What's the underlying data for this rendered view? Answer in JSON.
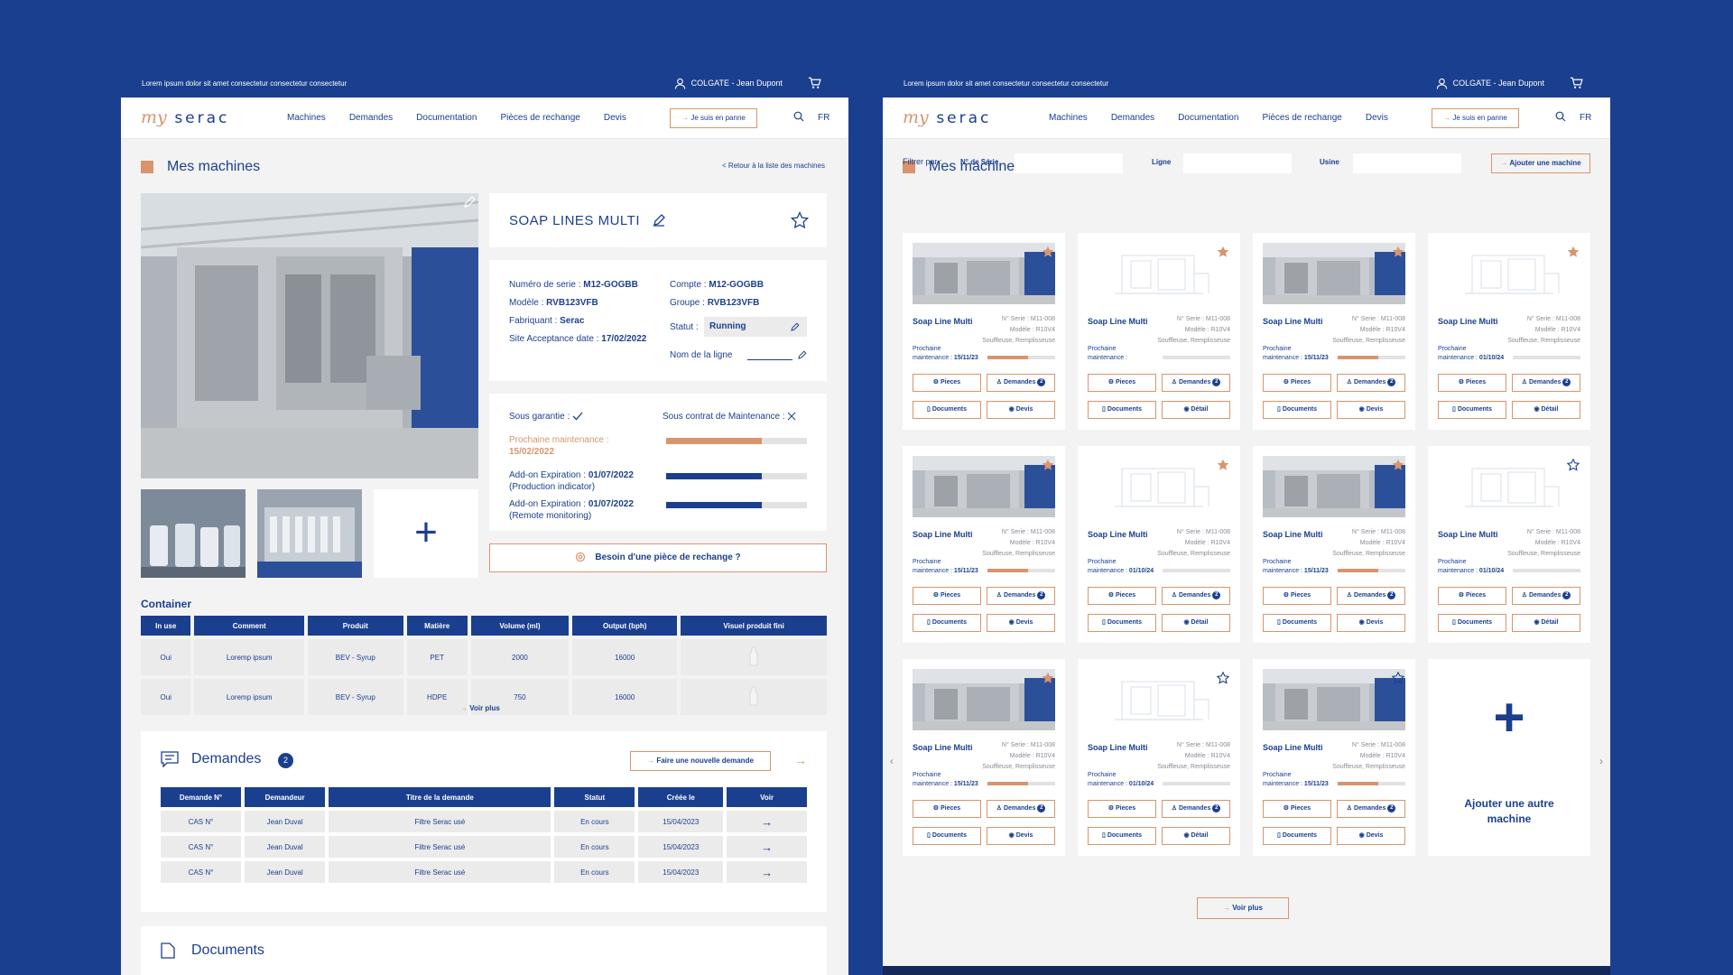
{
  "topbar": {
    "text": "Lorem ipsum dolor sit amet consectetur consectetur consectetur",
    "user": "COLGATE - Jean Dupont"
  },
  "logo": {
    "my": "my",
    "serac": "serac"
  },
  "nav": {
    "items": [
      "Machines",
      "Demandes",
      "Documentation",
      "Pièces de rechange",
      "Devis"
    ],
    "panne": "Je suis en panne",
    "lang": "FR"
  },
  "colors": {
    "primary": "#1b3f8f",
    "accent": "#d9946e",
    "bg": "#f3f3f3"
  },
  "left": {
    "title": "Mes machines",
    "back": "< Retour à la liste des machines",
    "machine_name": "SOAP LINES MULTI",
    "plus": "+",
    "info": {
      "serie_label": "Numéro de serie : ",
      "serie": "M12-GOGBB",
      "modele_label": "Modèle : ",
      "modele": "RVB123VFB",
      "fabriquant_label": "Fabriquant : ",
      "fabriquant": "Serac",
      "site_label": "Site Acceptance date : ",
      "site": "17/02/2022",
      "compte_label": "Compte : ",
      "compte": "M12-GOGBB",
      "groupe_label": "Groupe : ",
      "groupe": "RVB123VFB",
      "statut_label": "Statut : ",
      "statut": "Running",
      "ligne_label": "Nom de la ligne"
    },
    "garantie": {
      "sous_garantie": "Sous garantie : ",
      "sous_contrat": "Sous contrat de Maintenance : ",
      "prochaine_label": "Prochaine maintenance :",
      "prochaine_date": "15/02/2022",
      "prochaine_pct": 0.68,
      "addon1_label": "Add-on Expiration : ",
      "addon1_date": "01/07/2022",
      "addon1_sub": "(Production indicator)",
      "addon1_pct": 0.68,
      "addon2_label": "Add-on Expiration : ",
      "addon2_date": "01/07/2022",
      "addon2_sub": "(Remote monitoring)",
      "addon2_pct": 0.68
    },
    "piece_btn": "Besoin d'une pièce de rechange ?",
    "container": {
      "title": "Container",
      "headers": [
        "In use",
        "Comment",
        "Produit",
        "Matière",
        "Volume (ml)",
        "Output (bph)",
        "Visuel produit fini"
      ],
      "rows": [
        [
          "Oui",
          "Loremp ipsum",
          "BEV - Syrup",
          "PET",
          "2000",
          "16000"
        ],
        [
          "Oui",
          "Loremp ipsum",
          "BEV - Syrup",
          "HDPE",
          "750",
          "16000"
        ]
      ],
      "voir_plus": "Voir plus"
    },
    "demandes": {
      "title": "Demandes",
      "count": "2",
      "new_btn": "Faire une nouvelle demande",
      "headers": [
        "Demande N°",
        "Demandeur",
        "Titre de la demande",
        "Statut",
        "Créée le",
        "Voir"
      ],
      "rows": [
        [
          "CAS N°",
          "Jean Duval",
          "Filtre Serac usé",
          "En cours",
          "15/04/2023"
        ],
        [
          "CAS N°",
          "Jean Duval",
          "Filtre Serac usé",
          "En cours",
          "15/04/2023"
        ],
        [
          "CAS N°",
          "Jean Duval",
          "Filtre Serac usé",
          "En cours",
          "15/04/2023"
        ]
      ]
    },
    "documents_title": "Documents"
  },
  "right": {
    "title": "Mes machines",
    "filter_label": "Filtrer par :",
    "filters": [
      "N° de Série",
      "Ligne",
      "Usine"
    ],
    "ajouter": "Ajouter une machine",
    "card": {
      "name": "Soap Line Multi",
      "serie": "N° Serie : M11-008",
      "modele": "Modèle : R10V4",
      "type": "Souffleuse, Remplisseuse",
      "prochaine": "Prochaine",
      "maintenance": "maintenance : ",
      "btn_pieces": "Pieces",
      "btn_demandes": "Demandes",
      "badge": "2",
      "btn_documents": "Documents",
      "btn_devis": "Devis",
      "btn_detail": "Détail"
    },
    "cards": [
      {
        "photo": true,
        "fav": true,
        "date": "15/11/23",
        "pct": 0.6
      },
      {
        "photo": false,
        "fav": true,
        "date": "",
        "pct": 0
      },
      {
        "photo": true,
        "fav": true,
        "date": "15/11/23",
        "pct": 0.6
      },
      {
        "photo": false,
        "fav": true,
        "date": "01/10/24",
        "pct": 0
      },
      {
        "photo": true,
        "fav": true,
        "date": "15/11/23",
        "pct": 0.6
      },
      {
        "photo": false,
        "fav": true,
        "date": "01/10/24",
        "pct": 0
      },
      {
        "photo": true,
        "fav": true,
        "date": "15/11/23",
        "pct": 0.6
      },
      {
        "photo": false,
        "fav": false,
        "date": "01/10/24",
        "pct": 0
      },
      {
        "photo": true,
        "fav": true,
        "date": "15/11/23",
        "pct": 0.6
      },
      {
        "photo": false,
        "fav": false,
        "date": "01/10/24",
        "pct": 0
      },
      {
        "photo": true,
        "fav": false,
        "date": "15/11/23",
        "pct": 0.6
      }
    ],
    "add_card": {
      "plus": "+",
      "label": "Ajouter une autre machine"
    },
    "voir_plus": "Voir plus"
  }
}
